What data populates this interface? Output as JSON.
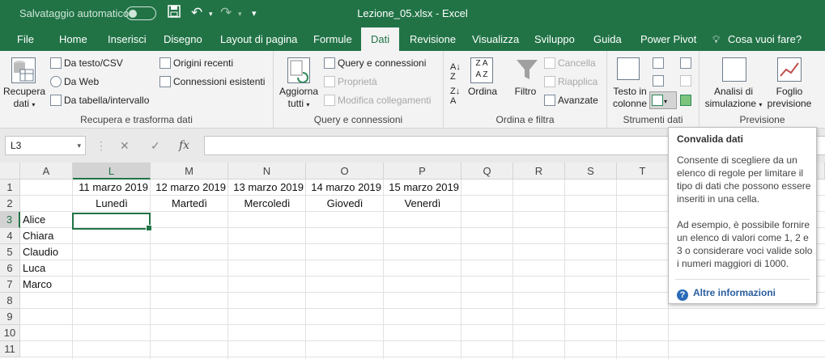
{
  "titlebar": {
    "autosave_label": "Salvataggio automatico",
    "save_icon": "save-icon",
    "undo_icon": "undo-icon",
    "redo_icon": "redo-icon",
    "customize_icon": "customize-icon",
    "window_title": "Lezione_05.xlsx  -  Excel",
    "color": "#217346"
  },
  "tabs": [
    "File",
    "Home",
    "Inserisci",
    "Disegno",
    "Layout di pagina",
    "Formule",
    "Dati",
    "Revisione",
    "Visualizza",
    "Sviluppo",
    "Guida",
    "Power Pivot",
    "Cosa vuoi fare?"
  ],
  "active_tab": "Dati",
  "ribbon": {
    "get_data": {
      "get_button": "Recupera dati",
      "get_button_l1": "Recupera",
      "get_button_l2": "dati",
      "from_text": "Da testo/CSV",
      "from_web": "Da Web",
      "from_table": "Da tabella/intervallo",
      "recent_sources": "Origini recenti",
      "existing_connections": "Connessioni esistenti",
      "label": "Recupera e trasforma dati"
    },
    "queries": {
      "refresh_l1": "Aggiorna",
      "refresh_l2": "tutti",
      "queries_connections": "Query e connessioni",
      "properties": "Proprietà",
      "edit_links": "Modifica collegamenti",
      "label": "Query e connessioni"
    },
    "sort_filter": {
      "sort": "Ordina",
      "filter": "Filtro",
      "clear": "Cancella",
      "reapply": "Riapplica",
      "advanced": "Avanzate",
      "label": "Ordina e filtra"
    },
    "data_tools": {
      "text_columns_l1": "Testo in",
      "text_columns_l2": "colonne",
      "label": "Strumenti dati"
    },
    "forecast": {
      "whatif_l1": "Analisi di",
      "whatif_l2": "simulazione",
      "forecast_l1": "Foglio",
      "forecast_l2": "previsione",
      "label": "Previsione"
    }
  },
  "formula_bar": {
    "name_box": "L3",
    "fx": "fx",
    "value": ""
  },
  "sheet": {
    "columns": [
      "A",
      "L",
      "M",
      "N",
      "O",
      "P",
      "Q",
      "R",
      "S",
      "T"
    ],
    "selected_column": "L",
    "rows": [
      "1",
      "2",
      "3",
      "4",
      "5",
      "6",
      "7",
      "8",
      "9",
      "10",
      "11"
    ],
    "selected_row": "3",
    "dates": [
      "11 marzo 2019",
      "12 marzo 2019",
      "13 marzo 2019",
      "14 marzo 2019",
      "15 marzo 2019"
    ],
    "days": [
      "Lunedì",
      "Martedì",
      "Mercoledì",
      "Giovedì",
      "Venerdì"
    ],
    "names": [
      "Alice",
      "Chiara",
      "Claudio",
      "Luca",
      "Marco"
    ]
  },
  "tooltip": {
    "title": "Convalida dati",
    "p1": "Consente di scegliere da un elenco di regole per limitare il tipo di dati che possono essere inseriti in una cella.",
    "p2": "Ad esempio, è possibile fornire un elenco di valori come 1, 2 e 3 o considerare voci valide solo i numeri maggiori di 1000.",
    "more": "Altre informazioni"
  }
}
